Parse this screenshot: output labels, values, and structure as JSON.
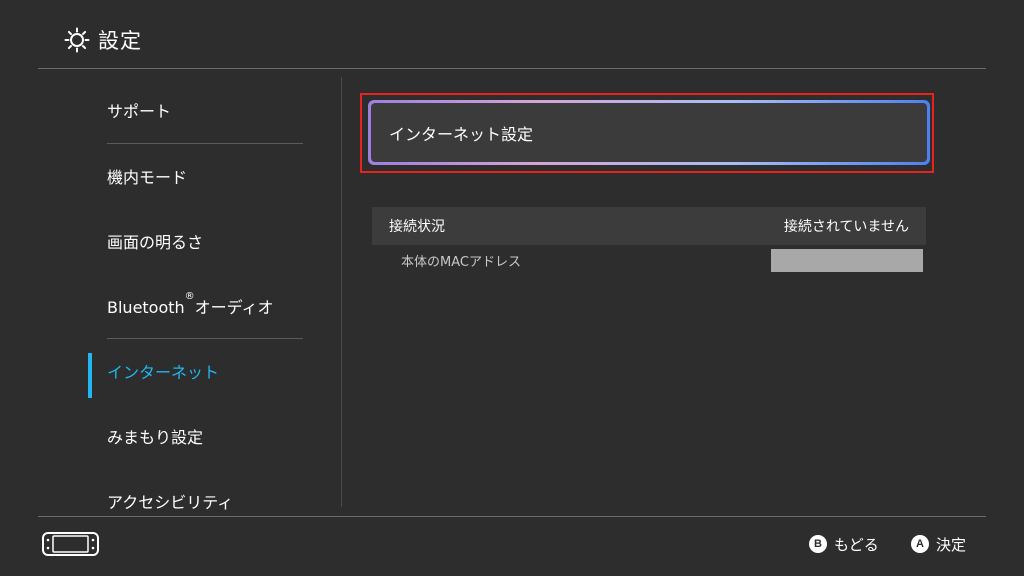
{
  "header": {
    "title": "設定",
    "icon": "gear-icon"
  },
  "sidebar": {
    "items": [
      {
        "label": "サポート",
        "active": false
      },
      {
        "label": "機内モード",
        "active": false
      },
      {
        "label": "画面の明るさ",
        "active": false
      },
      {
        "label": "Bluetooth",
        "label_sup": "®",
        "label_suffix": "オーディオ",
        "active": false
      },
      {
        "label": "インターネット",
        "active": true
      },
      {
        "label": "みまもり設定",
        "active": false
      },
      {
        "label": "アクセシビリティ",
        "active": false
      }
    ]
  },
  "main": {
    "settings_button_label": "インターネット設定",
    "connection_status_label": "接続状況",
    "connection_status_value": "接続されていません",
    "mac_address_label": "本体のMACアドレス"
  },
  "footer": {
    "back": {
      "button": "B",
      "label": "もどる"
    },
    "confirm": {
      "button": "A",
      "label": "決定"
    }
  },
  "colors": {
    "background": "#2d2d2d",
    "accent": "#21b6ef",
    "selection_frame": "#e8231b"
  }
}
